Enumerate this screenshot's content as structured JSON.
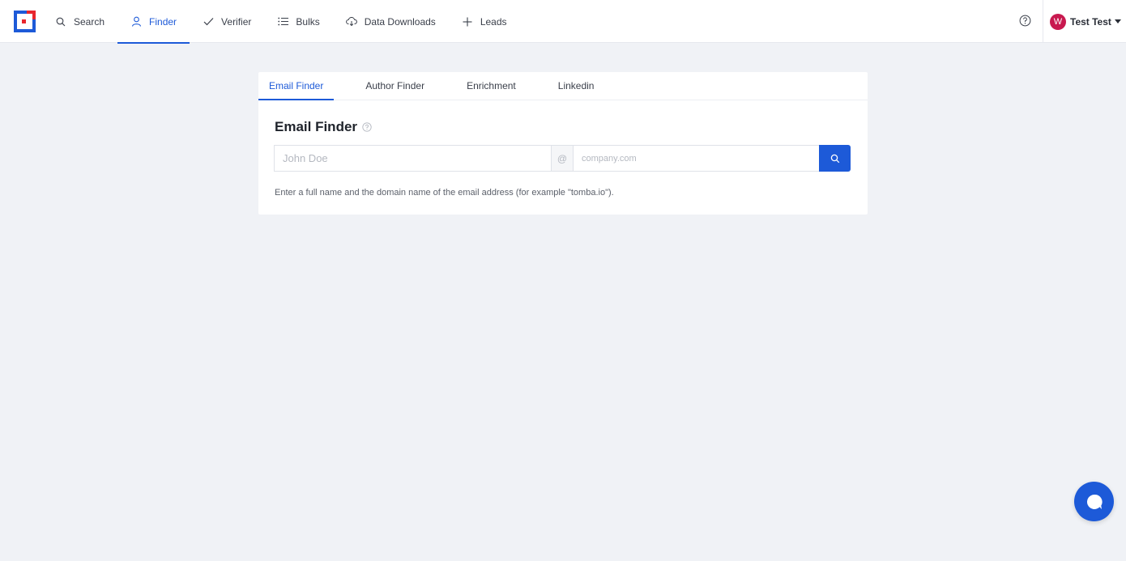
{
  "nav": {
    "items": [
      {
        "label": "Search",
        "icon": "search-icon"
      },
      {
        "label": "Finder",
        "icon": "user-icon",
        "active": true
      },
      {
        "label": "Verifier",
        "icon": "check-icon"
      },
      {
        "label": "Bulks",
        "icon": "list-icon"
      },
      {
        "label": "Data Downloads",
        "icon": "cloud-download-icon"
      },
      {
        "label": "Leads",
        "icon": "plus-icon"
      }
    ]
  },
  "user": {
    "initial": "W",
    "name": "Test Test",
    "avatar_color": "#c8194f"
  },
  "tabs": [
    {
      "label": "Email Finder",
      "active": true
    },
    {
      "label": "Author Finder"
    },
    {
      "label": "Enrichment"
    },
    {
      "label": "Linkedin"
    }
  ],
  "finder": {
    "title": "Email Finder",
    "name_placeholder": "John Doe",
    "at_symbol": "@",
    "domain_placeholder": "company.com",
    "hint": "Enter a full name and the domain name of the email address (for example \"tomba.io\")."
  },
  "colors": {
    "accent": "#1d5ad8",
    "background": "#f0f2f6",
    "logo_red": "#e8262d",
    "logo_blue": "#1d5ad8"
  }
}
